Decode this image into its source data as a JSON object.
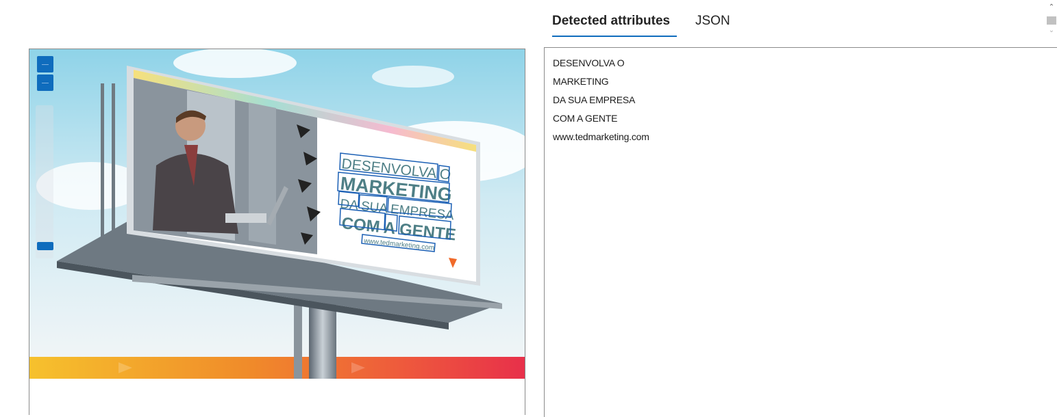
{
  "tabs": [
    {
      "label": "Detected attributes",
      "active": true
    },
    {
      "label": "JSON",
      "active": false
    }
  ],
  "detected_lines": [
    "DESENVOLVA O",
    "MARKETING",
    "DA SUA EMPRESA",
    "COM A GENTE",
    "www.tedmarketing.com"
  ],
  "billboard": {
    "line1": "DESENVOLVA O",
    "line2": "MARKETING",
    "line3": "DA SUA EMPRESA",
    "line4": "COM A GENTE",
    "url": "www.tedmarketing.com"
  },
  "colors": {
    "accent": "#0f6cbd",
    "box": "#1a5fb4",
    "billboard_text": "#4e7f86"
  },
  "icons": {
    "zoom_in": "plus-icon",
    "zoom_out": "minus-icon",
    "scroll_up": "chevron-up-icon",
    "scroll_down": "chevron-down-icon"
  }
}
